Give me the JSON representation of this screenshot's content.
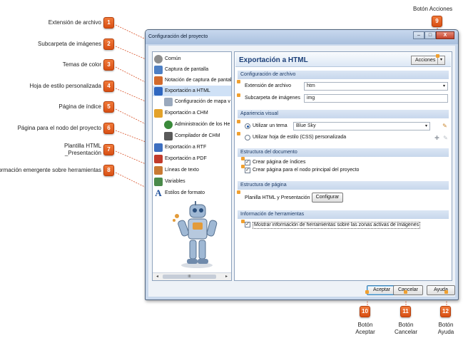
{
  "callouts": [
    {
      "num": "1",
      "label": "Extensión de archivo"
    },
    {
      "num": "2",
      "label": "Subcarpeta de imágenes"
    },
    {
      "num": "3",
      "label": "Temas de color"
    },
    {
      "num": "4",
      "label": "Hoja de estilo personalizada"
    },
    {
      "num": "5",
      "label": "Página de índice"
    },
    {
      "num": "6",
      "label": "Página para el nodo del proyecto"
    },
    {
      "num": "7",
      "label_line1": "Plantilla HTML",
      "label_line2": "_Presentación"
    },
    {
      "num": "8",
      "label": "Información emergente sobre herramientas"
    },
    {
      "num": "9",
      "label": "Botón Acciones"
    },
    {
      "num": "10",
      "label_line1": "Botón",
      "label_line2": "Aceptar"
    },
    {
      "num": "11",
      "label_line1": "Botón",
      "label_line2": "Cancelar"
    },
    {
      "num": "12",
      "label_line1": "Botón",
      "label_line2": "Ayuda"
    }
  ],
  "window": {
    "title": "Configuración del proyecto",
    "controls": {
      "minimize": "–",
      "maximize": "□",
      "close": "X"
    }
  },
  "tree": {
    "items": [
      {
        "label": "Común",
        "icon": "gear-icon",
        "color": "#8e8e8e"
      },
      {
        "label": "Captura de pantalla",
        "icon": "screenshot-icon",
        "color": "#4d7fc4"
      },
      {
        "label": "Notación de captura de pantal",
        "icon": "annotation-icon",
        "color": "#d26a2c"
      },
      {
        "label": "Exportación a HTML",
        "icon": "html-export-icon",
        "color": "#2f67c0"
      },
      {
        "label": "Configuración de mapa v",
        "icon": "image-map-icon",
        "color": "#9aa9bd"
      },
      {
        "label": "Exportación a CHM",
        "icon": "chm-export-icon",
        "color": "#e3a22a"
      },
      {
        "label": "Administración de los He",
        "icon": "help-admin-icon",
        "color": "#3a8a3a"
      },
      {
        "label": "Compilador de CHM",
        "icon": "compiler-icon",
        "color": "#5a5a5a"
      },
      {
        "label": "Exportación a RTF",
        "icon": "rtf-export-icon",
        "color": "#3d6fc0"
      },
      {
        "label": "Exportación a PDF",
        "icon": "pdf-export-icon",
        "color": "#c23b2b"
      },
      {
        "label": "Líneas de texto",
        "icon": "text-lines-icon",
        "color": "#c87a34"
      },
      {
        "label": "Variables",
        "icon": "variables-icon",
        "color": "#4a8a4a"
      },
      {
        "label": "Estilos de formato",
        "icon": "font-style-icon",
        "color": "#1d4f9a"
      }
    ],
    "scroll_thumb": "III"
  },
  "panel": {
    "title": "Exportación a HTML",
    "acciones": {
      "label": "Acciones",
      "arrow": "▾"
    },
    "sections": {
      "config_archivo": "Configuración de archivo",
      "apariencia": "Apariencia visual",
      "estructura_doc": "Estructura del documento",
      "estructura_pag": "Estructura de página",
      "info_herramientas": "Información de herramientas"
    },
    "extension": {
      "label": "Extensión de archivo",
      "value": "htm",
      "arrow": "▾"
    },
    "subcarpeta": {
      "label": "Subcarpeta de imágenes",
      "value": "img"
    },
    "tema": {
      "radio_label": "Utilizar un tema",
      "value": "Blue Sky",
      "arrow": "▾"
    },
    "css": {
      "radio_label": "Utilizar hoja de estilo (CSS) personalizada"
    },
    "indice": {
      "label": "Crear página de índices",
      "check": "✓"
    },
    "nodo": {
      "label": "Crear página para el nodo principal del proyecto",
      "check": "✓"
    },
    "plantilla": {
      "label": "Planilla HTML y Presentación",
      "button": "Configurar"
    },
    "tooltips": {
      "label": "Mostrar información de herramientas sobre las zonas activas de imágenes",
      "check": "✓"
    }
  },
  "footer": {
    "ok": "Aceptar",
    "cancel": "Cancelar",
    "help": "Ayuda"
  },
  "colors": {
    "badge": "#e0621f",
    "accent": "#1c3f78",
    "section": "#c7d7ec",
    "lines": "#d9532a"
  }
}
